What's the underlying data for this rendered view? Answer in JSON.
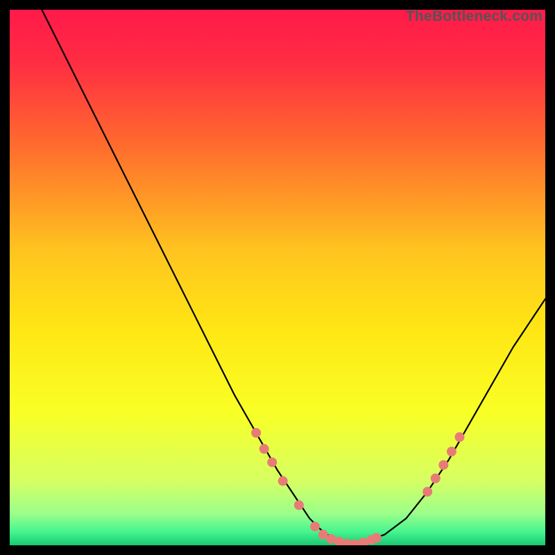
{
  "watermark": "TheBottleneck.com",
  "chart_data": {
    "type": "line",
    "title": "",
    "xlabel": "",
    "ylabel": "",
    "xlim": [
      0,
      100
    ],
    "ylim": [
      0,
      100
    ],
    "background_gradient": {
      "stops": [
        {
          "offset": 0.0,
          "color": "#ff1a4b"
        },
        {
          "offset": 0.1,
          "color": "#ff2d42"
        },
        {
          "offset": 0.25,
          "color": "#ff6a2e"
        },
        {
          "offset": 0.45,
          "color": "#ffc41f"
        },
        {
          "offset": 0.6,
          "color": "#ffe714"
        },
        {
          "offset": 0.75,
          "color": "#f9ff25"
        },
        {
          "offset": 0.88,
          "color": "#d6ff63"
        },
        {
          "offset": 0.94,
          "color": "#9cff8a"
        },
        {
          "offset": 0.975,
          "color": "#45f58e"
        },
        {
          "offset": 1.0,
          "color": "#19c873"
        }
      ]
    },
    "series": [
      {
        "name": "bottleneck-curve",
        "color": "#000000",
        "stroke_width": 2.2,
        "x": [
          6,
          10,
          14,
          18,
          22,
          26,
          30,
          34,
          38,
          42,
          46,
          50,
          52,
          54,
          56,
          58,
          60,
          62,
          64,
          66,
          70,
          74,
          78,
          82,
          86,
          90,
          94,
          98,
          100
        ],
        "y": [
          100,
          92,
          84,
          76,
          68,
          60,
          52,
          44,
          36,
          28,
          21,
          14,
          11,
          8,
          5,
          3,
          1.5,
          0.6,
          0.2,
          0.6,
          2,
          5,
          10,
          16,
          23,
          30,
          37,
          43,
          46
        ]
      }
    ],
    "markers": {
      "name": "highlight-dots",
      "color": "#e77c76",
      "radius": 7,
      "points": [
        {
          "x": 46,
          "y": 21
        },
        {
          "x": 47.5,
          "y": 18
        },
        {
          "x": 49,
          "y": 15.5
        },
        {
          "x": 51,
          "y": 12
        },
        {
          "x": 54,
          "y": 7.5
        },
        {
          "x": 57,
          "y": 3.5
        },
        {
          "x": 58.5,
          "y": 2
        },
        {
          "x": 60,
          "y": 1.2
        },
        {
          "x": 61.5,
          "y": 0.7
        },
        {
          "x": 63,
          "y": 0.3
        },
        {
          "x": 64.5,
          "y": 0.2
        },
        {
          "x": 66,
          "y": 0.5
        },
        {
          "x": 67.5,
          "y": 1
        },
        {
          "x": 68.5,
          "y": 1.4
        },
        {
          "x": 78,
          "y": 10
        },
        {
          "x": 79.5,
          "y": 12.5
        },
        {
          "x": 81,
          "y": 15
        },
        {
          "x": 82.5,
          "y": 17.5
        },
        {
          "x": 84,
          "y": 20.2
        }
      ]
    }
  }
}
